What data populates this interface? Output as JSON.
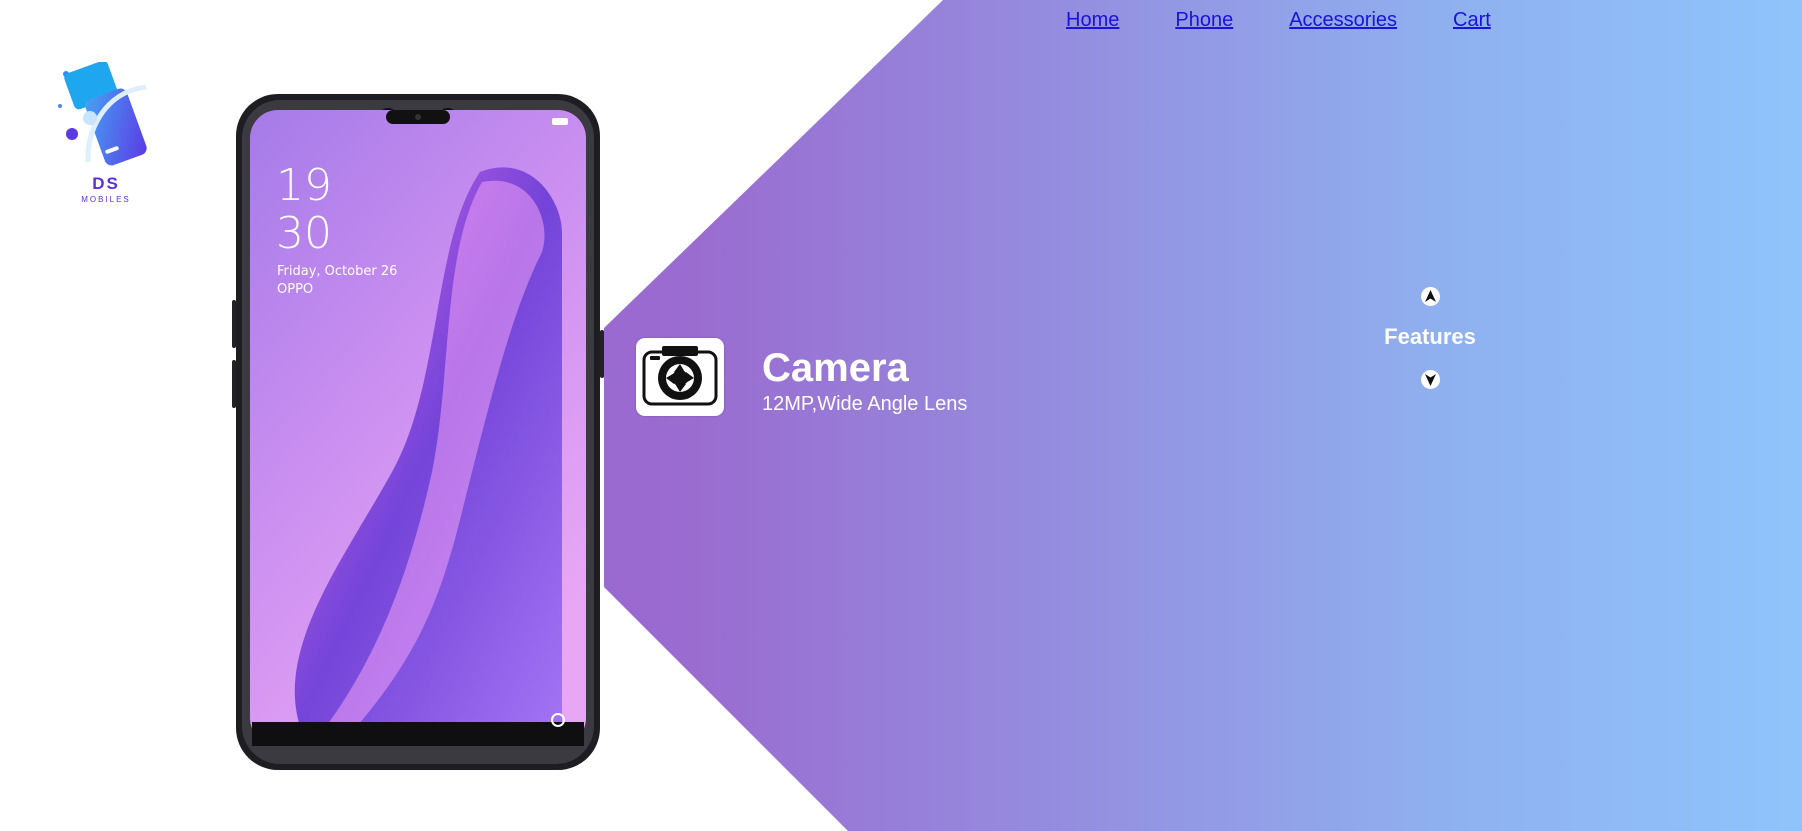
{
  "nav": {
    "items": [
      "Home",
      "Phone",
      "Accessories",
      "Cart"
    ]
  },
  "logo": {
    "line1": "DS",
    "line2": "MOBILES"
  },
  "phone_screen": {
    "hour": "19",
    "minute": "30",
    "date": "Friday,  October 26",
    "brand": "OPPO"
  },
  "feature": {
    "icon": "camera-icon",
    "title": "Camera",
    "description": "12MP,Wide Angle Lens"
  },
  "features_nav": {
    "label": "Features",
    "up_icon": "arrow-up-icon",
    "down_icon": "arrow-down-icon"
  },
  "colors": {
    "gradient_start": "#9460cb",
    "gradient_end": "#8fc4fb",
    "nav_link": "#1a13d9",
    "logo": "#5b2ee0"
  }
}
